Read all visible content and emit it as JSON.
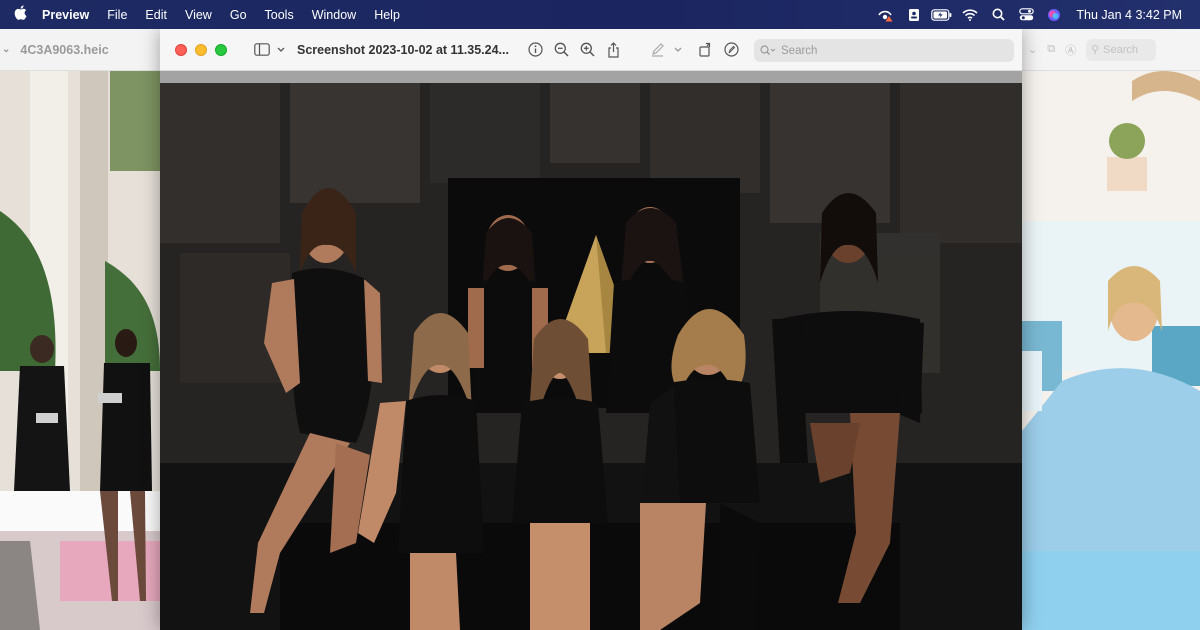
{
  "menubar": {
    "app_name": "Preview",
    "menus": [
      "File",
      "Edit",
      "View",
      "Go",
      "Tools",
      "Window",
      "Help"
    ],
    "clock": "Thu Jan 4  3:42 PM",
    "status_icons": [
      "screen-share-alert-icon",
      "contact-card-icon",
      "battery-charging-icon",
      "wifi-icon",
      "spotlight-search-icon",
      "control-center-icon",
      "siri-icon"
    ]
  },
  "left_window": {
    "title": "4C3A9063.heic"
  },
  "main_window": {
    "title": "Screenshot 2023-10-02 at 11.35.24...",
    "search_placeholder": "Search"
  },
  "right_window": {
    "search_placeholder": "Search"
  },
  "colors": {
    "menubar": "#1d2a63",
    "traffic_red": "#fe5f57",
    "traffic_yellow": "#febc2e",
    "traffic_green": "#28c840"
  }
}
